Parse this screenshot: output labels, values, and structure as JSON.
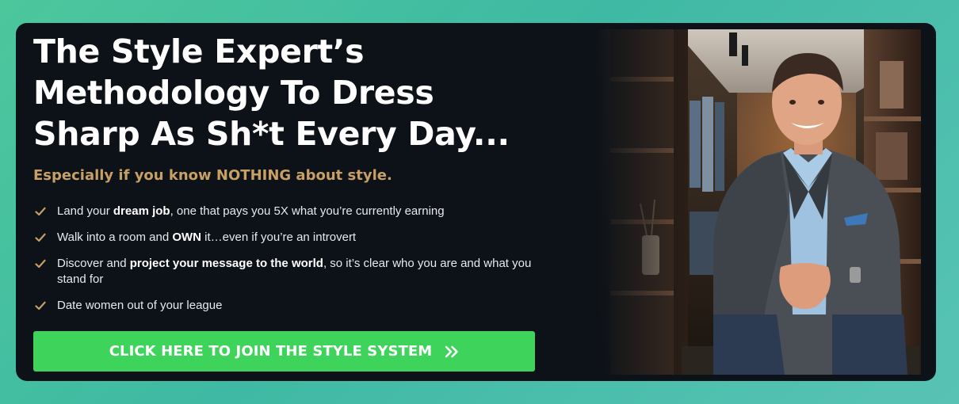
{
  "headline": {
    "line1": "The Style Expert’s",
    "line2": "Methodology To Dress",
    "line3": "Sharp As Sh*t Every Day..."
  },
  "subhead": "Especially if you know NOTHING about style.",
  "bullets": [
    {
      "pre": "Land your ",
      "bold": "dream job",
      "post": ", one that pays you 5X what you’re currently earning"
    },
    {
      "pre": "Walk into a room and ",
      "bold": "OWN",
      "post": " it…even if you’re an introvert"
    },
    {
      "pre": "Discover and ",
      "bold": "project your message to the world",
      "post": ", so it’s clear who you are and what you stand for"
    },
    {
      "pre": "Date women out of your league",
      "bold": "",
      "post": ""
    }
  ],
  "cta": {
    "label": "CLICK HERE TO JOIN THE STYLE SYSTEM",
    "icon": "double-chevron-right-icon"
  },
  "icons": {
    "bullet": "check-icon"
  },
  "colors": {
    "card_bg": "#0d1218",
    "accent_gold": "#c8a064",
    "cta_green": "#3ed35a",
    "page_bg": "#4cc79c"
  }
}
